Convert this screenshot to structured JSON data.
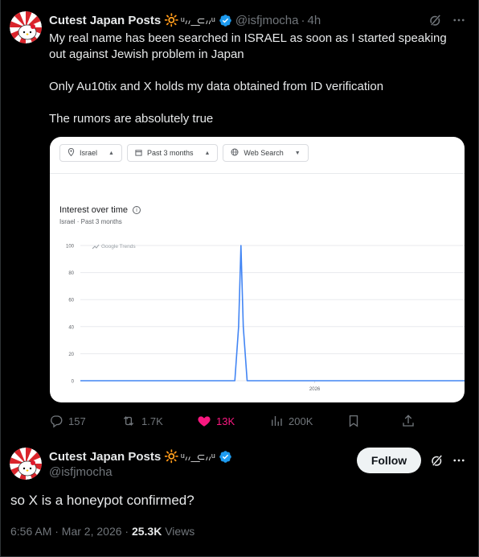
{
  "tweet1": {
    "author_name": "Cutest Japan Posts",
    "emoji": "🔆",
    "kaomoji": "ᵘ៸៸ ͟ ⊂៸៸ᵘ",
    "handle": "@isfjmocha",
    "separator": "·",
    "time": "4h",
    "lines": [
      "My real name has been searched in ISRAEL as soon as I started speaking out against Jewish problem in Japan",
      "Only Au10tix and X holds my data obtained from ID verification",
      "The rumors are absolutely true"
    ],
    "actions": {
      "replies": "157",
      "reposts": "1.7K",
      "likes": "13K",
      "views": "200K"
    }
  },
  "trends_card": {
    "filters": [
      "Israel",
      "Past 3 months",
      "Web Search"
    ],
    "title": "Interest over time",
    "subtitle": "Israel · Past 3 months",
    "watermark": "Google Trends"
  },
  "chart_data": {
    "type": "line",
    "title": "Interest over time",
    "xlabel": "",
    "ylabel": "",
    "ylim": [
      0,
      100
    ],
    "yticks": [
      0,
      20,
      40,
      60,
      80,
      100
    ],
    "xticks": [
      {
        "label": "2026",
        "pos": 0.61
      }
    ],
    "x_range": [
      0,
      100
    ],
    "series": [
      {
        "values": [
          {
            "x": 0,
            "y": 0
          },
          {
            "x": 40.2,
            "y": 0
          },
          {
            "x": 41.2,
            "y": 40
          },
          {
            "x": 41.8,
            "y": 100
          },
          {
            "x": 42.4,
            "y": 40
          },
          {
            "x": 43.4,
            "y": 0
          },
          {
            "x": 100,
            "y": 0
          }
        ]
      }
    ],
    "colors": {
      "line": "#4285f4",
      "grid": "#e8eaed"
    }
  },
  "tweet2": {
    "author_name": "Cutest Japan Posts",
    "emoji": "🔆",
    "kaomoji": "ᵘ៸៸ ͟ ⊂៸៸ᵘ",
    "handle": "@isfjmocha",
    "follow_label": "Follow",
    "text": "so X is a honeypot confirmed?",
    "timestamp": "6:56 AM · Mar 2, 2026 · ",
    "views_count": "25.3K",
    "views_label": " Views"
  },
  "colors": {
    "background": "#000000",
    "muted": "#71767b",
    "text": "#e7e9ea",
    "like": "#f91880",
    "verified": "#1d9bf0"
  }
}
